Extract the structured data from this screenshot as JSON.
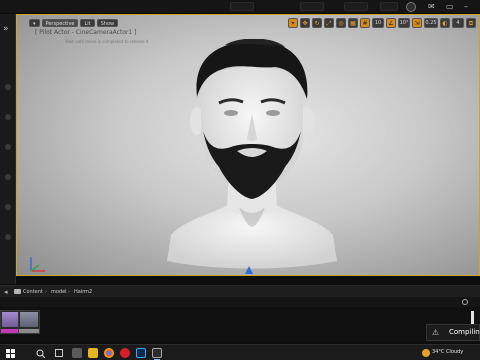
{
  "viewport": {
    "mode_button": "Perspective",
    "lighting_button": "Lit",
    "show_button": "Show",
    "actor_label": "[ Pilot Actor - CineCameraActor1 ]",
    "actor_sublabel": "Wait until move is completed to release it",
    "snap_angle": "10°",
    "snap_scale": "0.25",
    "camera_speed": "4"
  },
  "content_browser": {
    "path": [
      "Content",
      "model",
      "Hairm2"
    ]
  },
  "notification": {
    "text": "Compiling",
    "icon": "warning-icon"
  },
  "taskbar": {
    "weather": "34°C Cloudy",
    "apps": [
      "file-explorer-icon",
      "folder-icon",
      "chrome-icon",
      "opera-icon",
      "photoshop-icon",
      "unreal-engine-icon"
    ]
  },
  "colors": {
    "viewport_border": "#c9a52a",
    "accent_orange": "#d68a1a",
    "taskbar_bg": "#1b1b1b"
  }
}
